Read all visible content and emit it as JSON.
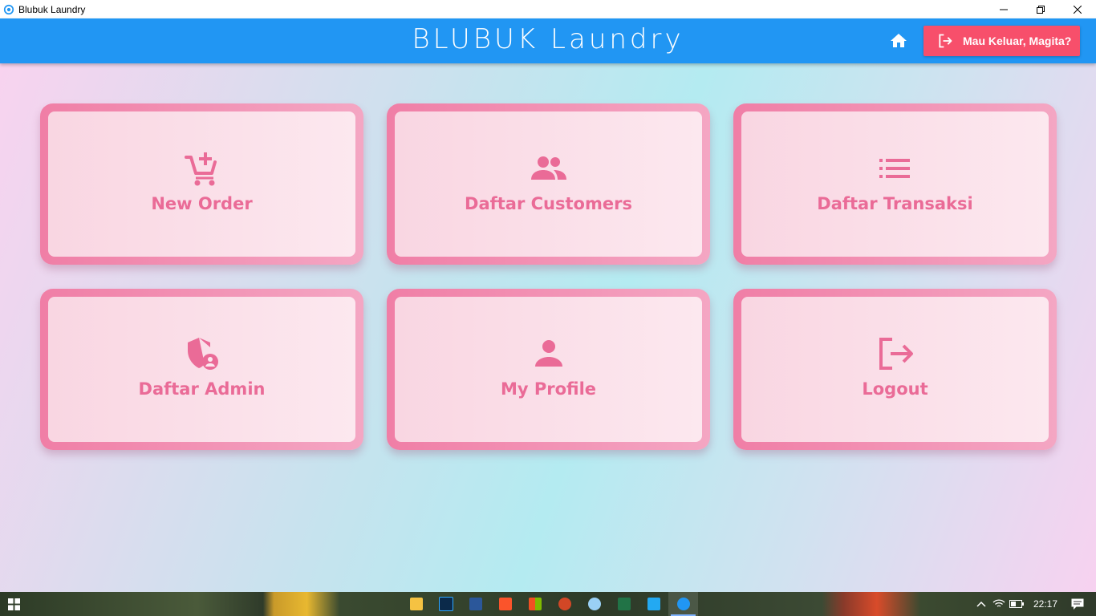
{
  "window": {
    "title": "Blubuk Laundry"
  },
  "appbar": {
    "brand": "BLUBUK Laundry",
    "home_icon": "home-icon",
    "logout_label": "Mau Keluar, Magita?",
    "logout_icon": "logout-icon"
  },
  "menu": [
    {
      "label": "New Order",
      "icon": "cart-plus-icon"
    },
    {
      "label": "Daftar Customers",
      "icon": "users-icon"
    },
    {
      "label": "Daftar Transaksi",
      "icon": "list-icon"
    },
    {
      "label": "Daftar Admin",
      "icon": "admin-shield-icon"
    },
    {
      "label": "My Profile",
      "icon": "person-icon"
    },
    {
      "label": "Logout",
      "icon": "logout-icon"
    }
  ],
  "taskbar": {
    "apps": [
      "file-explorer-icon",
      "photoshop-icon",
      "word-icon",
      "brave-icon",
      "store-icon",
      "powerpoint-icon",
      "paint-icon",
      "excel-icon",
      "vscode-icon",
      "blubuk-laundry-icon"
    ],
    "clock": "22:17"
  },
  "colors": {
    "appbar": "#2196f3",
    "logout_button": "#f74f6b",
    "card_border": "#f07ea6",
    "card_text": "#ea6b97"
  }
}
